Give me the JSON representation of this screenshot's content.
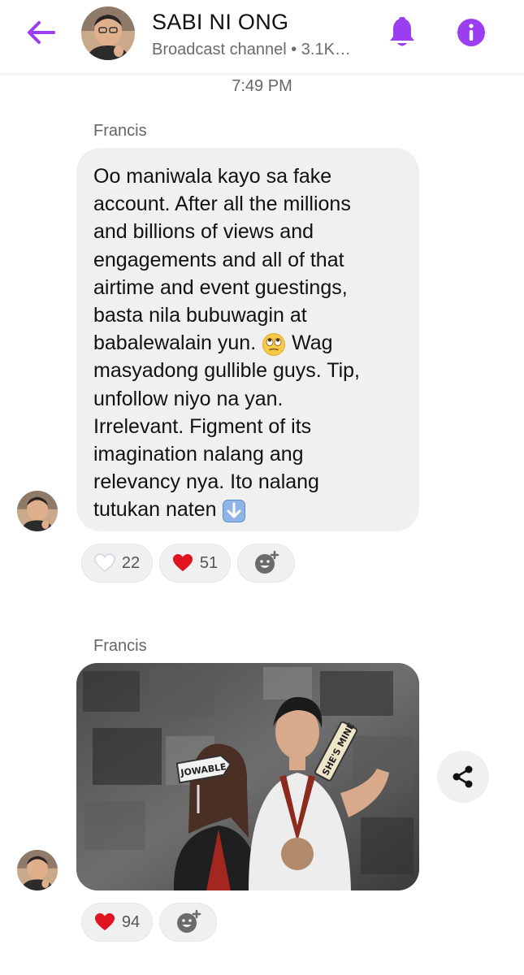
{
  "header": {
    "title": "SABI NI ONG",
    "subtitle": "Broadcast channel • 3.1K…",
    "back_icon": "arrow-left-icon",
    "bell_icon": "bell-icon",
    "info_icon": "info-icon",
    "accent_color": "#9b3df0"
  },
  "timestamp": "7:49 PM",
  "messages": [
    {
      "sender": "Francis",
      "lines": [
        "Oo maniwala kayo sa fake",
        "account. After all the millions",
        "and billions of views and",
        "engagements and all of that",
        "airtime and event guestings,",
        "basta nila bubuwagin at",
        "babalewalain yun.",
        "masyadong gullible guys. Tip,",
        "unfollow niyo na yan.",
        "Irrelevant. Figment of its",
        "imagination nalang ang",
        "relevancy nya. Ito nalang",
        "tutukan naten"
      ],
      "line7_tail": "Wag",
      "emoji_1": "eye-roll-emoji",
      "emoji_2": "down-arrow-emoji",
      "reactions": [
        {
          "icon": "white-heart-icon",
          "count": "22"
        },
        {
          "icon": "red-heart-icon",
          "count": "51"
        },
        {
          "icon": "add-reaction-icon",
          "count": ""
        }
      ]
    },
    {
      "sender": "Francis",
      "photo_signs": [
        "JOWABLE",
        "SHE'S MINE"
      ],
      "share_icon": "share-icon",
      "reactions": [
        {
          "icon": "red-heart-icon",
          "count": "94"
        },
        {
          "icon": "add-reaction-icon",
          "count": ""
        }
      ]
    }
  ]
}
